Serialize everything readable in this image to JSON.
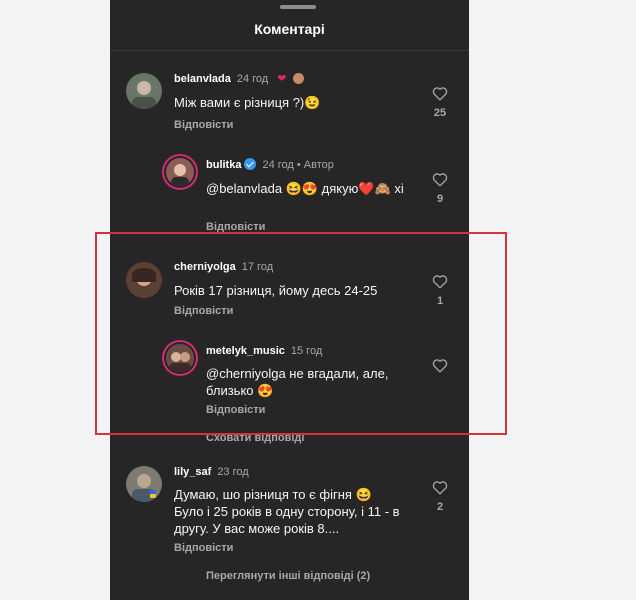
{
  "header": {
    "title": "Коментарі"
  },
  "colors": {
    "highlight": "#d7323a",
    "background": "#262626",
    "like_heart": "#e0245e"
  },
  "comments": [
    {
      "user": "belanvlada",
      "time": "24 год",
      "reactions": "❤️",
      "text": "Між вами є різниця ?)😉",
      "reply_label": "Відповісти",
      "likes": "25"
    },
    {
      "user": "bulitka",
      "time": "24 год • Автор",
      "text": "@belanvlada 😆😍 дякую❤️🙈 хі",
      "reply_label": "Відповісти",
      "likes": "9"
    },
    {
      "user": "cherniyolga",
      "time": "17 год",
      "text": "Років 17 різниця, йому десь 24-25",
      "reply_label": "Відповісти",
      "likes": "1"
    },
    {
      "user": "metelyk_music",
      "time": "15 год",
      "text": "@cherniyolga не вгадали, але, близько 😍",
      "reply_label": "Відповісти"
    },
    {
      "user": "lily_saf",
      "time": "23 год",
      "text": "Думаю, шо різниця то є фігня 😆 Було і 25 років в одну сторону, і 11 - в другу. У вас може років 8....",
      "reply_label": "Відповісти",
      "likes": "2"
    }
  ],
  "links": {
    "hide_replies": "Сховати відповіді",
    "view_more_replies": "Переглянути інші відповіді (2)"
  },
  "icons": {
    "like": "heart-outline-icon",
    "verified": "verified-badge-icon",
    "drag": "drag-handle-icon"
  }
}
